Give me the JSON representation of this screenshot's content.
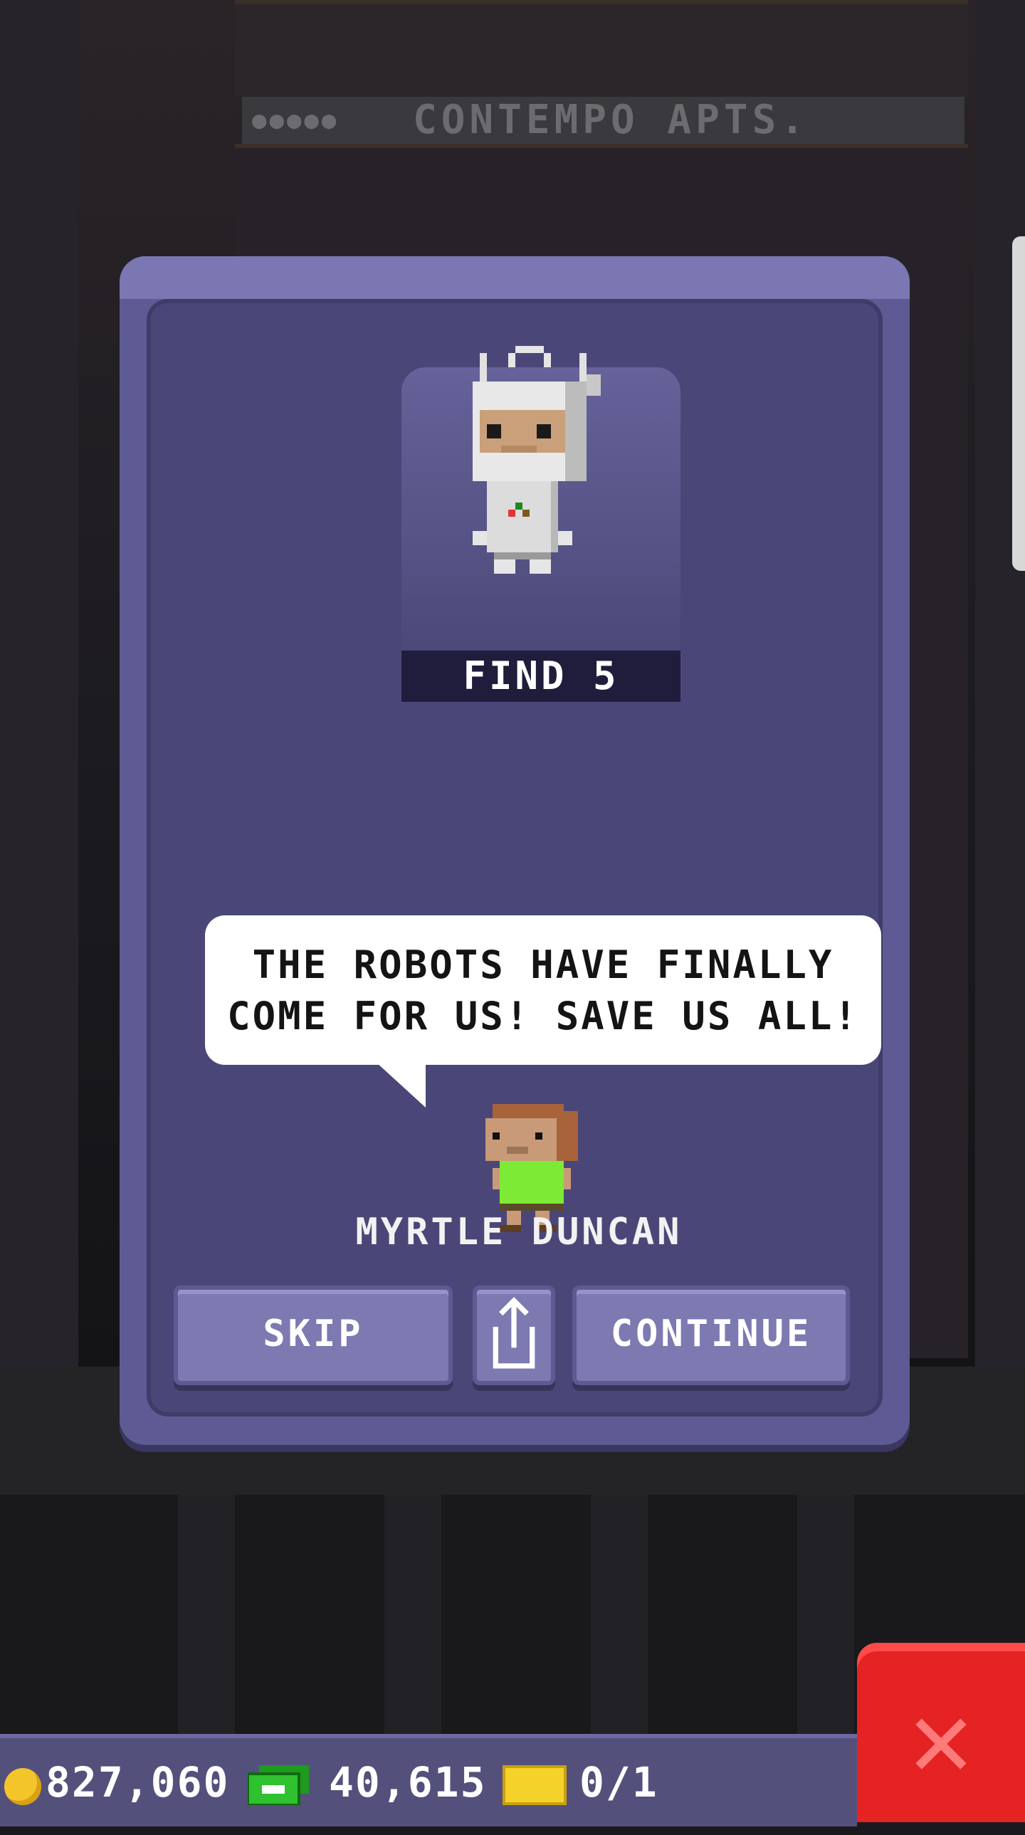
{
  "background": {
    "building_sign": "CONTEMPO APTS."
  },
  "mission": {
    "find_label": "FIND 5"
  },
  "speech": {
    "text": "THE ROBOTS HAVE FINALLY\nCOME FOR US! SAVE US ALL!"
  },
  "character": {
    "name": "MYRTLE DUNCAN"
  },
  "buttons": {
    "skip": "SKIP",
    "continue": "CONTINUE",
    "share_icon": "share-icon"
  },
  "close_icon": "close-icon",
  "status": {
    "coins": "827,060",
    "bux": "40,615",
    "tickets": "0/1"
  },
  "colors": {
    "dialog": "#5e5a94",
    "close": "#e52323",
    "coin": "#f4c52a",
    "bux": "#1e9a1e",
    "ticket": "#f4d22a"
  }
}
